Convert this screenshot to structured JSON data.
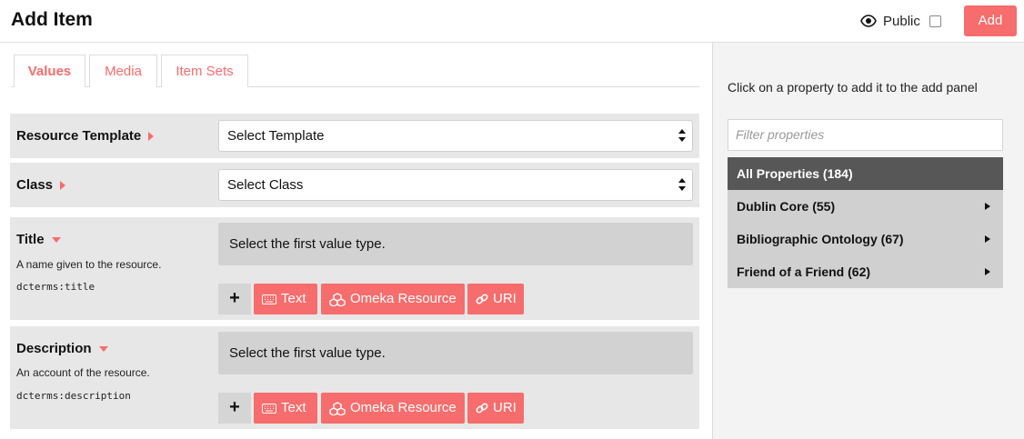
{
  "header": {
    "title": "Add Item",
    "public_label": "Public",
    "add_label": "Add"
  },
  "tabs": [
    {
      "label": "Values",
      "active": true
    },
    {
      "label": "Media",
      "active": false
    },
    {
      "label": "Item Sets",
      "active": false
    }
  ],
  "form": {
    "resource_template": {
      "label": "Resource Template",
      "value": "Select Template"
    },
    "class": {
      "label": "Class",
      "value": "Select Class"
    },
    "properties": [
      {
        "label": "Title",
        "description": "A name given to the resource.",
        "term": "dcterms:title",
        "placeholder": "Select the first value type.",
        "buttons": {
          "add": "+",
          "text": "Text",
          "omeka": "Omeka Resource",
          "uri": "URI"
        }
      },
      {
        "label": "Description",
        "description": "An account of the resource.",
        "term": "dcterms:description",
        "placeholder": "Select the first value type.",
        "buttons": {
          "add": "+",
          "text": "Text",
          "omeka": "Omeka Resource",
          "uri": "URI"
        }
      }
    ]
  },
  "sidebar": {
    "help_text": "Click on a property to add it to the add panel",
    "filter_placeholder": "Filter properties",
    "all_properties": "All Properties (184)",
    "vocabularies": [
      {
        "label": "Dublin Core (55)"
      },
      {
        "label": "Bibliographic Ontology (67)"
      },
      {
        "label": "Friend of a Friend (62)"
      }
    ]
  },
  "colors": {
    "accent": "#f76c6c",
    "row_bg": "#e7e7e7",
    "sidebar_bg": "#f3f3f3",
    "all_props_bg": "#575757"
  },
  "icons": {
    "public": "eye-icon",
    "text": "keyboard-icon",
    "omeka": "cubes-icon",
    "uri": "link-icon"
  }
}
